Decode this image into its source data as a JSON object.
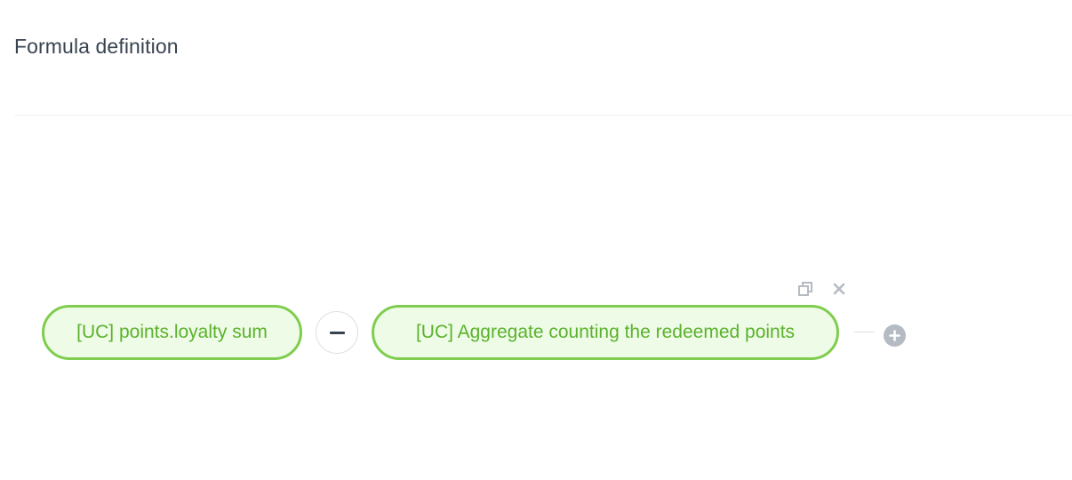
{
  "header": {
    "title": "Formula definition"
  },
  "formula": {
    "nodes": [
      {
        "label": "[UC] points.loyalty sum"
      },
      {
        "label": "[UC] Aggregate counting the redeemed points"
      }
    ],
    "operator": {
      "symbol": "minus-icon"
    },
    "node_actions": {
      "duplicate_icon": "duplicate-icon",
      "remove_icon": "close-icon"
    },
    "add_icon": "plus-icon"
  },
  "colors": {
    "node_border": "#7fcd4e",
    "node_fill": "#eefbe6",
    "node_text": "#5ab22c",
    "title_text": "#384350",
    "muted_icon": "#b5bbc2"
  }
}
